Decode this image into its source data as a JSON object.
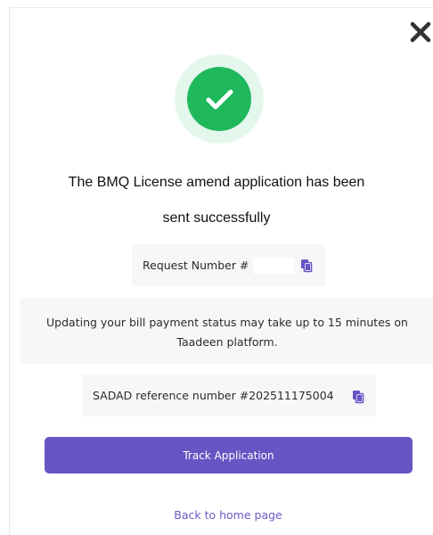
{
  "dialog": {
    "close_icon": "close-icon",
    "success_icon": "checkmark-icon",
    "title_line_1": "The BMQ License amend application has been",
    "title_line_2": "sent successfully",
    "request_number_label": "Request Number #",
    "request_copy_icon": "copy-icon",
    "info_line_1": "Updating your bill payment status may take up to 15 minutes on",
    "info_line_2": "Taadeen platform.",
    "sadad_text": "SADAD reference number #202511175004",
    "sadad_copy_icon": "copy-icon",
    "track_button_label": "Track Application",
    "home_link_label": "Back to home page"
  },
  "colors": {
    "primary": "#6755c4",
    "success": "#1fb85c",
    "success_ring": "#e4f7ec",
    "panel": "#f6f7f8",
    "link": "#6a5ac8"
  }
}
